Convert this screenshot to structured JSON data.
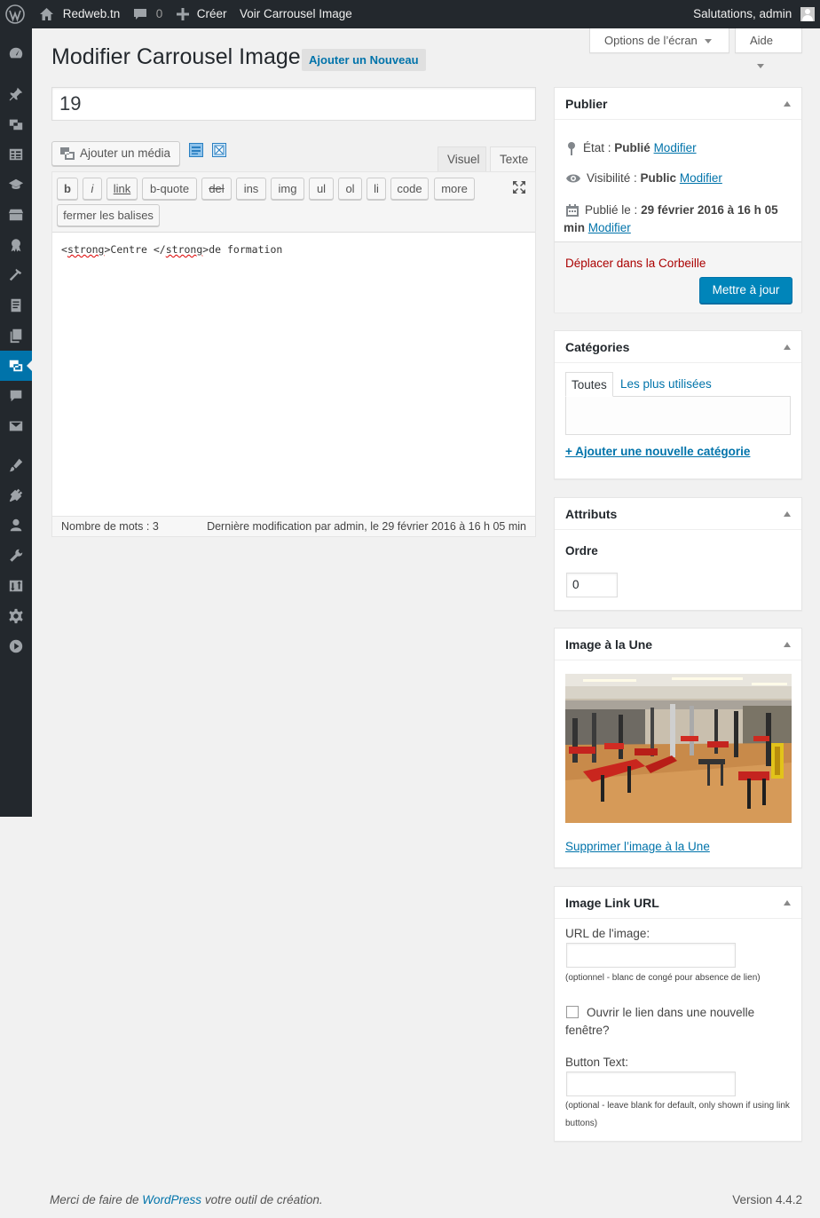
{
  "admin_bar": {
    "site_name": "Redweb.tn",
    "comments_count": "0",
    "new_label": "Créer",
    "view_label": "Voir Carrousel Image",
    "howdy": "Salutations, admin"
  },
  "admin_menu": {
    "icons": [
      "dashboard-icon",
      "pin-icon",
      "media-icon",
      "table-icon",
      "graduation-icon",
      "store-icon",
      "award-icon",
      "hammer-icon",
      "page-icon",
      "pages-icon",
      "carousel-icon",
      "comments-icon",
      "mail-icon",
      "appearance-icon",
      "plugins-icon",
      "users-icon",
      "tools-icon",
      "import-icon",
      "settings-icon",
      "play-icon"
    ],
    "current": "carousel-icon"
  },
  "header": {
    "title": "Modifier Carrousel Image",
    "add_new": "Ajouter un Nouveau",
    "screen_options": "Options de l’écran",
    "help": "Aide"
  },
  "post": {
    "title": "19"
  },
  "editor": {
    "add_media": "Ajouter un média",
    "tab_visual": "Visuel",
    "tab_text": "Texte",
    "quicktags": [
      "b",
      "i",
      "link",
      "b-quote",
      "del",
      "ins",
      "img",
      "ul",
      "ol",
      "li",
      "code",
      "more"
    ],
    "close_tags": "fermer les balises",
    "content_parts": [
      "<",
      "strong",
      ">Centre </",
      "strong",
      ">de formation"
    ],
    "word_count": "Nombre de mots : 3",
    "last_edit": "Dernière modification par admin, le 29 février 2016 à 16 h 05 min"
  },
  "publish": {
    "title": "Publier",
    "status_label": "État :",
    "status_value": "Publié",
    "visibility_label": "Visibilité :",
    "visibility_value": "Public",
    "published_label": "Publié le :",
    "published_value_1": "29 février 2016 à 16 h 05",
    "published_value_2": "min",
    "edit_link": "Modifier",
    "trash": "Déplacer dans la Corbeille",
    "update": "Mettre à jour"
  },
  "categories": {
    "title": "Catégories",
    "tab_all": "Toutes",
    "tab_popular": "Les plus utilisées",
    "add_new": "+ Ajouter une nouvelle catégorie"
  },
  "attributes": {
    "title": "Attributs",
    "order_label": "Ordre",
    "order_value": "0"
  },
  "featured_image": {
    "title": "Image à la Une",
    "remove": "Supprimer l’image à la Une"
  },
  "image_link": {
    "title": "Image Link URL",
    "url_label": "URL de l'image:",
    "url_note": "(optionnel - blanc de congé pour absence de lien)",
    "new_window_label": "Ouvrir le lien dans une nouvelle fenêtre?",
    "button_text_label": "Button Text:",
    "button_note": "(optional - leave blank for default, only shown if using link buttons)"
  },
  "footer": {
    "thanks_prefix": "Merci de faire de ",
    "thanks_link": "WordPress",
    "thanks_suffix": " votre outil de création.",
    "version": "Version 4.4.2"
  },
  "colors": {
    "admin_dark": "#23282d",
    "accent": "#0073aa",
    "primary_button": "#0085ba",
    "trash": "#a00"
  }
}
